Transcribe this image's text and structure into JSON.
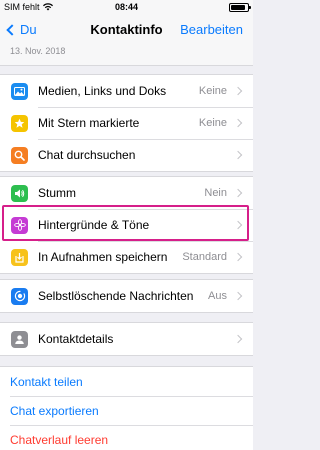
{
  "status_bar": {
    "carrier": "SIM fehlt",
    "time": "08:44",
    "battery_level": 0.9
  },
  "nav": {
    "back_label": "Du",
    "title": "Kontaktinfo",
    "edit_label": "Bearbeiten"
  },
  "date_label": "13. Nov. 2018",
  "group1": [
    {
      "label": "Medien, Links und Doks",
      "value": "Keine",
      "icon": "photo-icon",
      "color": "#1a8cf0"
    },
    {
      "label": "Mit Stern markierte",
      "value": "Keine",
      "icon": "star-icon",
      "color": "#f5c400"
    },
    {
      "label": "Chat durchsuchen",
      "value": "",
      "icon": "search-icon",
      "color": "#f57e22"
    }
  ],
  "group2": [
    {
      "label": "Stumm",
      "value": "Nein",
      "icon": "speaker-icon",
      "color": "#2dbe4f"
    },
    {
      "label": "Hintergründe & Töne",
      "value": "",
      "icon": "flower-icon",
      "color": "#c53bd4"
    },
    {
      "label": "In Aufnahmen speichern",
      "value": "Standard",
      "icon": "save-icon",
      "color": "#f7c21b"
    }
  ],
  "group3": [
    {
      "label": "Selbstlöschende Nachrichten",
      "value": "Aus",
      "icon": "timer-icon",
      "color": "#1a7cf0"
    }
  ],
  "group4": [
    {
      "label": "Kontaktdetails",
      "value": "",
      "icon": "contact-icon",
      "color": "#8e8e93"
    }
  ],
  "actions": {
    "share": "Kontakt teilen",
    "export": "Chat exportieren",
    "clear": "Chatverlauf leeren"
  },
  "colors": {
    "accent": "#0a7bfe",
    "danger": "#ff3b30",
    "highlight": "#d61f8a"
  }
}
